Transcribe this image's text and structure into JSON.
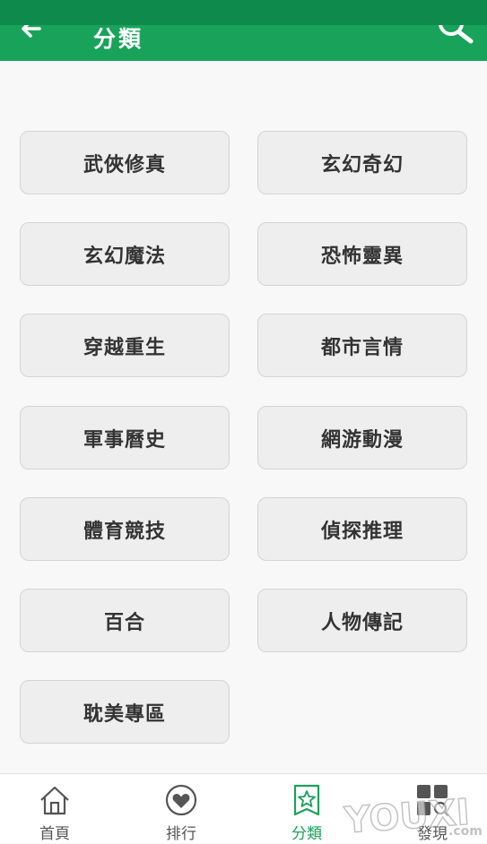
{
  "header": {
    "title": "分類",
    "back_icon": "back-arrow-icon",
    "search_icon": "search-icon"
  },
  "categories": [
    "武俠修真",
    "玄幻奇幻",
    "玄幻魔法",
    "恐怖靈異",
    "穿越重生",
    "都市言情",
    "軍事曆史",
    "網游動漫",
    "體育競技",
    "偵探推理",
    "百合",
    "人物傳記",
    "耽美專區"
  ],
  "bottom_nav": [
    {
      "label": "首頁",
      "icon": "home-icon",
      "active": false
    },
    {
      "label": "排行",
      "icon": "heart-icon",
      "active": false
    },
    {
      "label": "分類",
      "icon": "star-bookmark-icon",
      "active": true
    },
    {
      "label": "發現",
      "icon": "discover-grid-icon",
      "active": false
    }
  ],
  "watermark": {
    "text": "YOUXI",
    "suffix": ".com"
  },
  "colors": {
    "brand": "#19a35a",
    "status_bar": "#0e8a4d",
    "tile": "#eeeeee"
  }
}
